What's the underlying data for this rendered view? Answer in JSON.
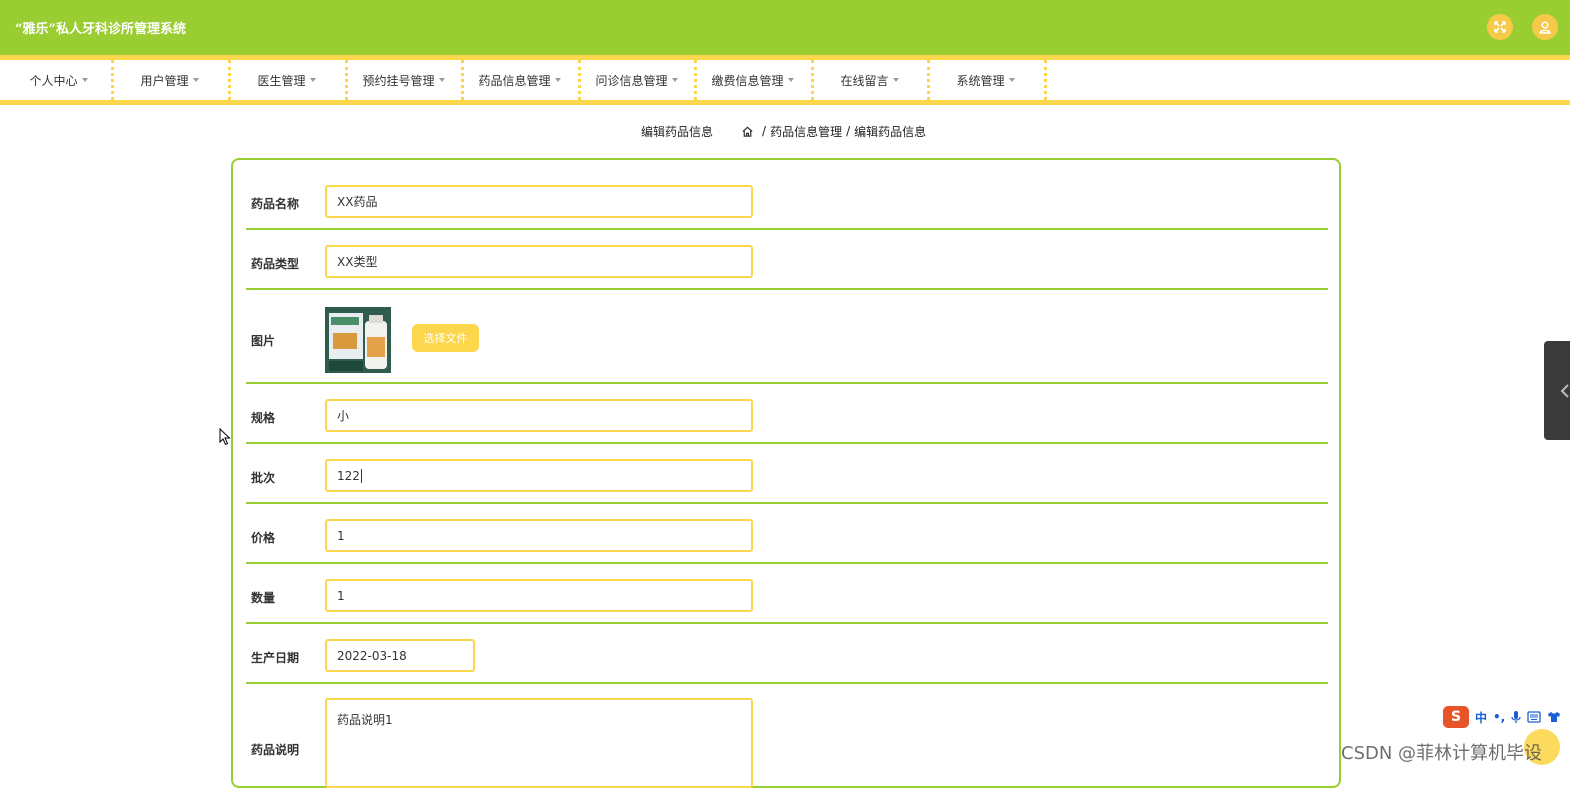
{
  "header": {
    "title": "“雅乐”私人牙科诊所管理系统",
    "icons": [
      "fullscreen-icon",
      "user-icon"
    ]
  },
  "nav": {
    "items": [
      {
        "label": "个人中心"
      },
      {
        "label": "用户管理"
      },
      {
        "label": "医生管理"
      },
      {
        "label": "预约挂号管理"
      },
      {
        "label": "药品信息管理"
      },
      {
        "label": "问诊信息管理"
      },
      {
        "label": "缴费信息管理"
      },
      {
        "label": "在线留言"
      },
      {
        "label": "系统管理"
      }
    ]
  },
  "breadcrumb": {
    "page_title": "编辑药品信息",
    "path": [
      "药品信息管理",
      "编辑药品信息"
    ],
    "separator": "/"
  },
  "form": {
    "name": {
      "label": "药品名称",
      "value": "XX药品"
    },
    "type": {
      "label": "药品类型",
      "value": "XX类型"
    },
    "image": {
      "label": "图片",
      "button": "选择文件"
    },
    "spec": {
      "label": "规格",
      "value": "小"
    },
    "batch": {
      "label": "批次",
      "value": "122"
    },
    "price": {
      "label": "价格",
      "value": "1"
    },
    "quantity": {
      "label": "数量",
      "value": "1"
    },
    "production_date": {
      "label": "生产日期",
      "value": "2022-03-18"
    },
    "description": {
      "label": "药品说明",
      "value": "药品说明1"
    }
  },
  "ime": {
    "logo": "S",
    "mode": "中",
    "punct": "•,"
  },
  "watermark": "CSDN @菲林计算机毕设",
  "colors": {
    "primary_green": "#9acd32",
    "accent_yellow": "#fcd64c"
  }
}
